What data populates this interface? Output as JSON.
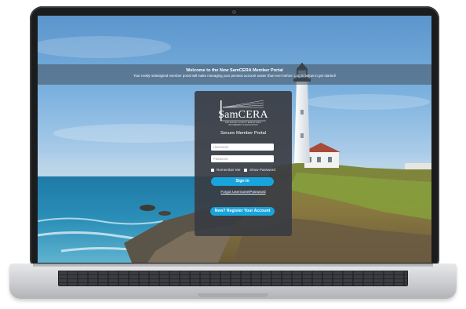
{
  "banner": {
    "title": "Welcome to the New SamCERA Member Portal",
    "subtitle": "Your newly redesigned member portal will make managing your pension account easier than ever before. Log in below to get started!"
  },
  "login": {
    "logo_text": "SamCERA",
    "logo_tagline": "SAN MATEO COUNTY EMPLOYEES' RETIREMENT ASSOCIATION",
    "portal_title": "Secure Member Portal",
    "username_placeholder": "Username",
    "password_placeholder": "Password",
    "remember_me": "Remember Me",
    "show_password": "Show Password",
    "sign_in": "Sign In",
    "forgot": "Forgot Username/Password",
    "register": "New? Register Your Account"
  },
  "colors": {
    "accent": "#18a4dc",
    "card": "#3a3c42"
  }
}
